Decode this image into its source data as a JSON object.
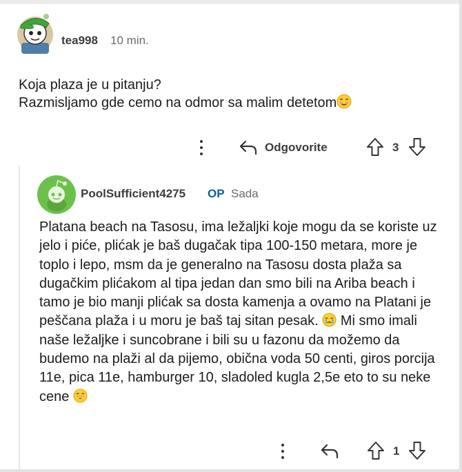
{
  "comment": {
    "author": "tea998",
    "time": "10 min.",
    "avatar": "snoo-avatar-green-cap",
    "lines": [
      "Koja plaza je u pitanju?",
      "Razmisljamo gde cemo na odmor sa malim detetom"
    ],
    "emoji": "smiling-face-emoji",
    "actions": {
      "more": "kebab-menu-icon",
      "reply_label": "Odgovorite",
      "vote_count": "3"
    }
  },
  "reply": {
    "author": "PoolSufficient4275",
    "op_badge": "OP",
    "time": "Sada",
    "avatar": "snoo-avatar-green",
    "text_before_emoji1": "Platana beach na Tasosu, ima ležaljki koje mogu da se koriste uz jelo i piće, plićak je baš dugačak tipa 100-150 metara, more je toplo i lepo, msm da je generalno na Tasosu dosta plaža sa dugačkim plićakom al tipa jedan dan smo bili na Ariba beach i tamo je bio manji plićak sa dosta kamenja a ovamo na Platani je peščana plaža i u moru je baš taj sitan pesak.",
    "text_after_emoji1": "Mi smo imali naše ležaljke i suncobrane i bili su u fazonu da možemo da budemo na plaži al da pijemo, obična voda 50 centi, giros porcija 11e, pica 11e, hamburger 10, sladoled kugla 2,5e eto to su neke cene",
    "emoji1": "crying-face-emoji",
    "emoji2": "grinning-face-emoji",
    "actions": {
      "more": "kebab-menu-icon",
      "vote_count": "1"
    }
  },
  "colors": {
    "text": "#1c1c1c",
    "meta": "#6b6b6b",
    "op": "#0b5ea8",
    "avatar_green": "#6cc14a",
    "thread_line": "#e6e6e6"
  }
}
